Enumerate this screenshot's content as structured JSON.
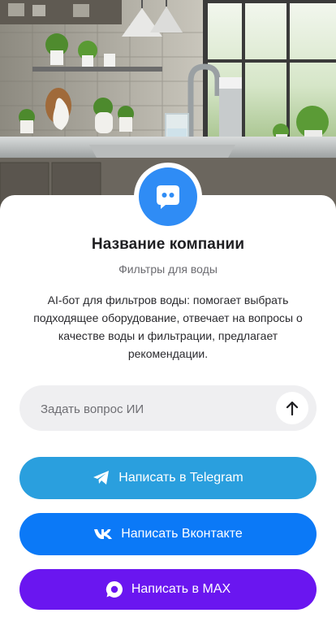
{
  "company": {
    "name": "Название компании",
    "subtitle": "Фильтры для воды",
    "description": "AI-бот для фильтров воды: помогает выбрать подходящее оборудование, отвечает на вопросы о качестве воды и фильтрации, предлагает рекомендации."
  },
  "ask": {
    "placeholder": "Задать вопрос ИИ",
    "send_icon": "arrow-up-icon"
  },
  "buttons": {
    "telegram": {
      "label": "Написать в Telegram",
      "icon": "telegram-icon",
      "color": "#2a9fde"
    },
    "vk": {
      "label": "Написать Вконтакте",
      "icon": "vk-icon",
      "color": "#0b79f7"
    },
    "max": {
      "label": "Написать в MAX",
      "icon": "max-icon",
      "color": "#6a16f0"
    }
  },
  "avatar": {
    "icon": "chat-bot-icon",
    "color": "#2f8cf5"
  }
}
